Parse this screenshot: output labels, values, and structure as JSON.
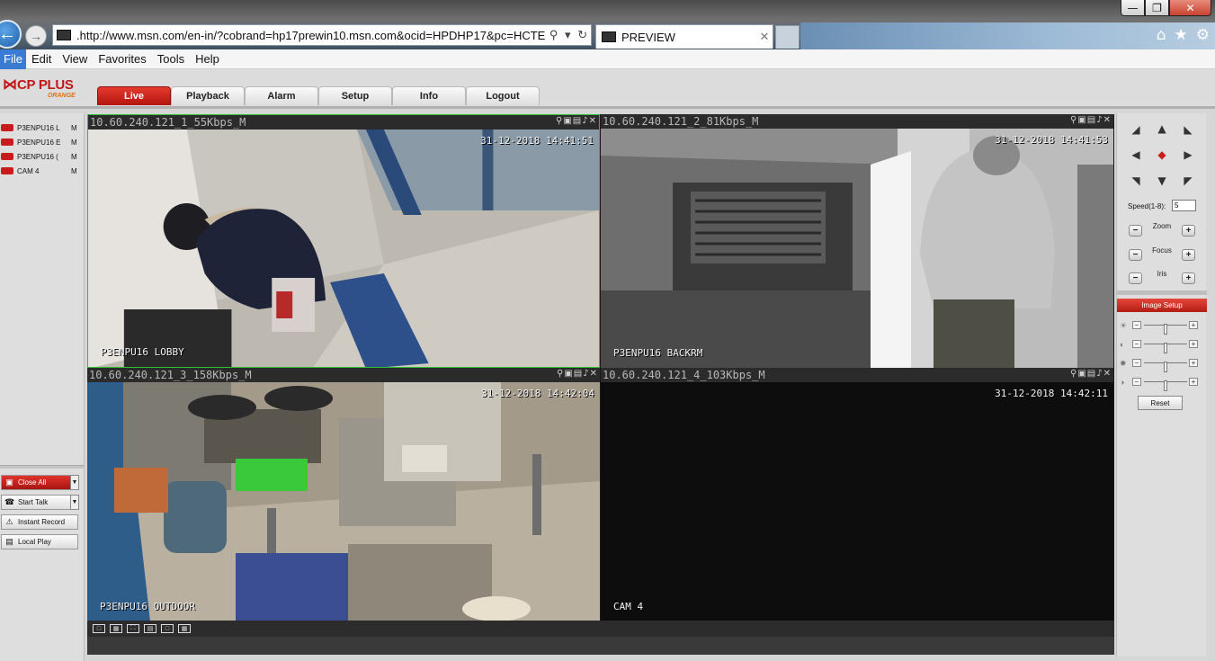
{
  "browser": {
    "url": ".http://www.msn.com/en-in/?cobrand=hp17prewin10.msn.com&ocid=HPDHP17&pc=HCTE",
    "tab_title": "PREVIEW",
    "menu": [
      "File",
      "Edit",
      "View",
      "Favorites",
      "Tools",
      "Help"
    ]
  },
  "app": {
    "logo_brand": "CP PLUS",
    "logo_sub": "ORANGE",
    "nav_tabs": [
      "Live",
      "Playback",
      "Alarm",
      "Setup",
      "Info",
      "Logout"
    ],
    "active_tab": "Live"
  },
  "devices": [
    {
      "name": "P3ENPU16 L",
      "stream": "M"
    },
    {
      "name": "P3ENPU16 E",
      "stream": "M"
    },
    {
      "name": "P3ENPU16 (",
      "stream": "M"
    },
    {
      "name": "CAM 4",
      "stream": "M"
    }
  ],
  "left_buttons": {
    "close_all": "Close All",
    "start_talk": "Start Talk",
    "instant_record": "Instant Record",
    "local_play": "Local Play"
  },
  "panes": [
    {
      "channel": "10.60.240.121_1_55Kbps_M",
      "timestamp": "31-12-2018 14:41:51",
      "label": "P3ENPU16 LOBBY"
    },
    {
      "channel": "10.60.240.121_2_81Kbps_M",
      "timestamp": "31-12-2018 14:41:53",
      "label": "P3ENPU16 BACKRM"
    },
    {
      "channel": "10.60.240.121_3_158Kbps_M",
      "timestamp": "31-12-2018 14:42:04",
      "label": "P3ENPU16 OUTDOOR"
    },
    {
      "channel": "10.60.240.121_4_103Kbps_M",
      "timestamp": "31-12-2018 14:42:11",
      "label": "CAM 4"
    }
  ],
  "ptz": {
    "speed_label": "Speed(1-8):",
    "speed_value": "5",
    "zoom": "Zoom",
    "focus": "Focus",
    "iris": "Iris",
    "image_setup": "Image Setup",
    "reset": "Reset"
  },
  "colors": {
    "accent_red": "#c8201a",
    "active_pane_border": "#2fbf2f"
  }
}
